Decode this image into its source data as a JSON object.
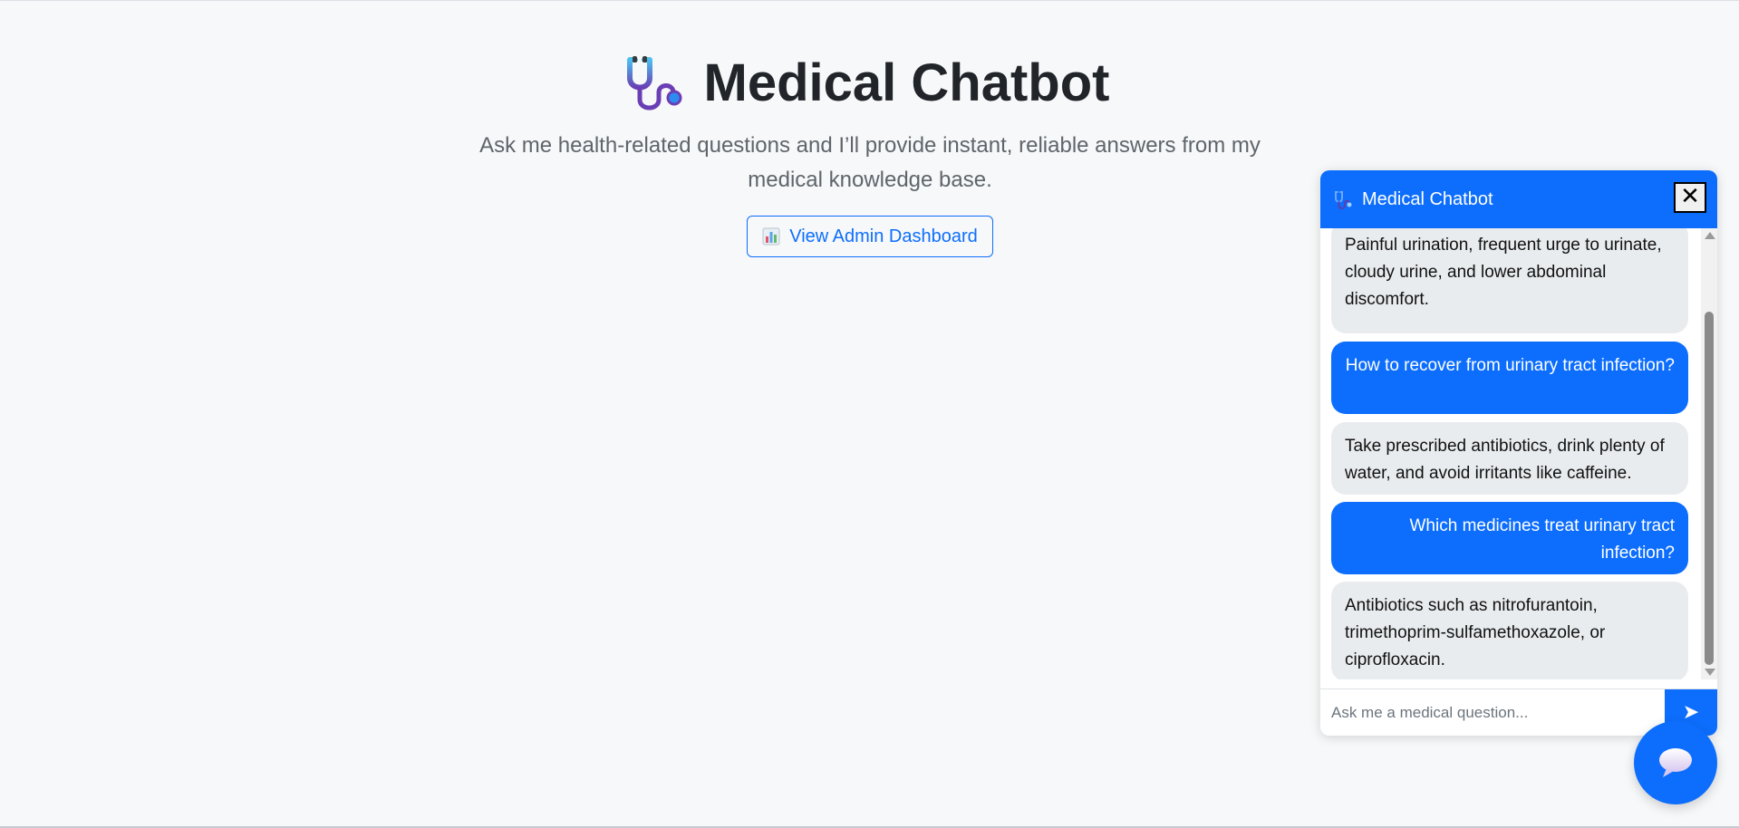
{
  "page": {
    "title": "Medical Chatbot",
    "subtitle": "Ask me health-related questions and I’ll provide instant, reliable answers from my medical knowledge base.",
    "admin_button_label": "View Admin Dashboard",
    "title_icon": "stethoscope-icon",
    "admin_icon": "bar-chart-icon"
  },
  "chat": {
    "header_title": "Medical Chatbot",
    "header_icon": "stethoscope-icon",
    "close_label": "✕",
    "messages": [
      {
        "role": "bot",
        "text": "Painful urination, frequent urge to urinate, cloudy urine, and lower abdominal discomfort."
      },
      {
        "role": "user",
        "text": "How to recover from urinary tract infection?"
      },
      {
        "role": "bot",
        "text": "Take prescribed antibiotics, drink plenty of water, and avoid irritants like caffeine."
      },
      {
        "role": "user",
        "text": "Which medicines treat urinary tract infection?"
      },
      {
        "role": "bot",
        "text": "Antibiotics such as nitrofurantoin, trimethoprim-sulfamethoxazole, or ciprofloxacin."
      }
    ],
    "input_placeholder": "Ask me a medical question...",
    "input_value": "",
    "send_icon": "send-arrow-icon"
  },
  "fab": {
    "icon": "speech-bubble-icon"
  },
  "colors": {
    "primary": "#0d6efd",
    "background": "#f7f8f9",
    "bot_bubble": "#e9ecef",
    "title_text": "#212529"
  }
}
